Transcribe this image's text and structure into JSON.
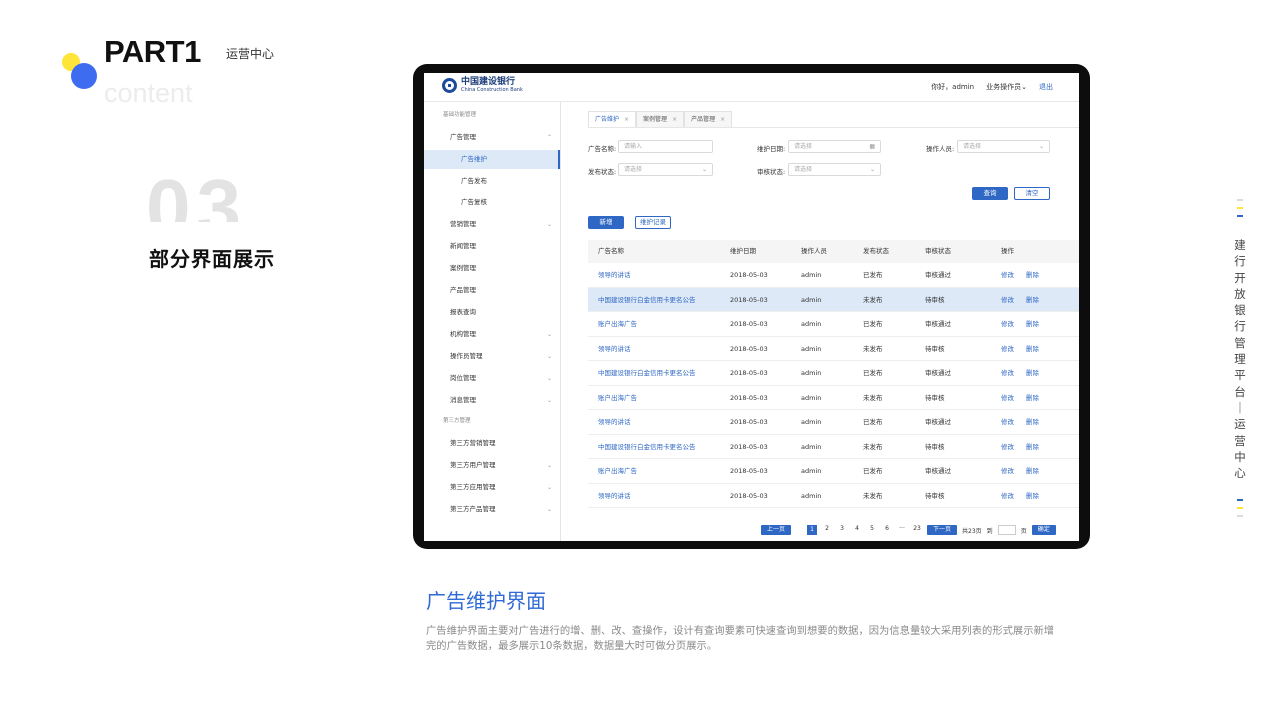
{
  "header": {
    "part": "PART1",
    "part_sub": "运营中心",
    "ghost_text": "content",
    "big_number": "03",
    "section_title": "部分界面展示"
  },
  "app": {
    "logo_cn": "中国建设银行",
    "logo_en": "China Construction Bank",
    "greeting": "你好，admin",
    "role": "业务操作员",
    "logout": "退出",
    "sidebar": [
      {
        "label": "基础功能管理",
        "type": "group"
      },
      {
        "label": "广告管理",
        "type": "l1",
        "arrow": "⌃"
      },
      {
        "label": "广告维护",
        "type": "l2",
        "active": true
      },
      {
        "label": "广告发布",
        "type": "l2"
      },
      {
        "label": "广告复核",
        "type": "l2"
      },
      {
        "label": "营销管理",
        "type": "l1",
        "arrow": "⌄"
      },
      {
        "label": "新闻管理",
        "type": "l1"
      },
      {
        "label": "案例管理",
        "type": "l1"
      },
      {
        "label": "产品管理",
        "type": "l1"
      },
      {
        "label": "报表查询",
        "type": "l1"
      },
      {
        "label": "机构管理",
        "type": "l1",
        "arrow": "⌄"
      },
      {
        "label": "操作员管理",
        "type": "l1",
        "arrow": "⌄"
      },
      {
        "label": "岗位管理",
        "type": "l1",
        "arrow": "⌄"
      },
      {
        "label": "消息管理",
        "type": "l1",
        "arrow": "⌄"
      },
      {
        "label": "第三方管理",
        "type": "group"
      },
      {
        "label": "第三方营销管理",
        "type": "l1"
      },
      {
        "label": "第三方用户管理",
        "type": "l1",
        "arrow": "⌄"
      },
      {
        "label": "第三方应用管理",
        "type": "l1",
        "arrow": "⌄"
      },
      {
        "label": "第三方产品管理",
        "type": "l1",
        "arrow": "⌄"
      }
    ],
    "tabs": [
      {
        "label": "广告维护",
        "active": true
      },
      {
        "label": "案例管理"
      },
      {
        "label": "产品管理"
      }
    ],
    "filters": {
      "ad_name_label": "广告名称:",
      "ad_name_placeholder": "请输入",
      "maint_date_label": "维护日期:",
      "maint_date_placeholder": "请选择",
      "operator_label": "操作人员:",
      "operator_placeholder": "请选择",
      "publish_status_label": "发布状态:",
      "publish_status_placeholder": "请选择",
      "review_status_label": "审核状态:",
      "review_status_placeholder": "请选择"
    },
    "buttons": {
      "query": "查询",
      "clear": "清空",
      "add": "新增",
      "log": "维护记录"
    },
    "table": {
      "columns": [
        "广告名称",
        "维护日期",
        "操作人员",
        "发布状态",
        "审核状态",
        "操作"
      ],
      "rows": [
        {
          "name": "领导的讲话",
          "date": "2018-05-03",
          "operator": "admin",
          "publish": "已发布",
          "review": "审核通过",
          "edit": "修改",
          "delete": "删除"
        },
        {
          "name": "中国建设银行白金信用卡更名公告",
          "date": "2018-05-03",
          "operator": "admin",
          "publish": "未发布",
          "review": "待审核",
          "edit": "修改",
          "delete": "删除",
          "highlight": true
        },
        {
          "name": "账户出海广告",
          "date": "2018-05-03",
          "operator": "admin",
          "publish": "已发布",
          "review": "审核通过",
          "edit": "修改",
          "delete": "删除"
        },
        {
          "name": "领导的讲话",
          "date": "2018-05-03",
          "operator": "admin",
          "publish": "未发布",
          "review": "待审核",
          "edit": "修改",
          "delete": "删除"
        },
        {
          "name": "中国建设银行白金信用卡更名公告",
          "date": "2018-05-03",
          "operator": "admin",
          "publish": "已发布",
          "review": "审核通过",
          "edit": "修改",
          "delete": "删除"
        },
        {
          "name": "账户出海广告",
          "date": "2018-05-03",
          "operator": "admin",
          "publish": "未发布",
          "review": "待审核",
          "edit": "修改",
          "delete": "删除"
        },
        {
          "name": "领导的讲话",
          "date": "2018-05-03",
          "operator": "admin",
          "publish": "已发布",
          "review": "审核通过",
          "edit": "修改",
          "delete": "删除"
        },
        {
          "name": "中国建设银行白金信用卡更名公告",
          "date": "2018-05-03",
          "operator": "admin",
          "publish": "未发布",
          "review": "待审核",
          "edit": "修改",
          "delete": "删除"
        },
        {
          "name": "账户出海广告",
          "date": "2018-05-03",
          "operator": "admin",
          "publish": "已发布",
          "review": "审核通过",
          "edit": "修改",
          "delete": "删除"
        },
        {
          "name": "领导的讲话",
          "date": "2018-05-03",
          "operator": "admin",
          "publish": "未发布",
          "review": "待审核",
          "edit": "修改",
          "delete": "删除"
        }
      ]
    },
    "pagination": {
      "prev": "上一页",
      "pages": [
        "1",
        "2",
        "3",
        "4",
        "5",
        "6",
        "···",
        "23"
      ],
      "current": "1",
      "next": "下一页",
      "total": "共23页",
      "goto": "到",
      "page_unit": "页",
      "confirm": "确定"
    }
  },
  "description": {
    "title": "广告维护界面",
    "text": "广告维护界面主要对广告进行的增、删、改、查操作，设计有查询要素可快速查询到想要的数据，因为信息量较大采用列表的形式展示新增完的广告数据，最多展示10条数据，数据量大时可做分页展示。"
  },
  "side_nav": {
    "text": "建行开放银行管理平台｜运营中心",
    "colors": {
      "accent_blue": "#2e67c4",
      "accent_yellow": "#ffe43a"
    }
  }
}
